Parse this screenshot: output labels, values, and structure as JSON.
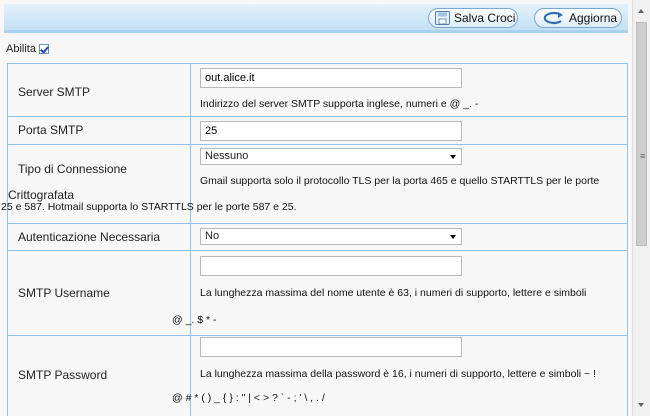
{
  "toolbar": {
    "save_label": "Salva Croci",
    "refresh_label": "Aggiorna"
  },
  "enable": {
    "label": "Abilita",
    "checked": true
  },
  "fields": {
    "server": {
      "label": "Server SMTP",
      "value": "out.alice.it",
      "hint": "Indirizzo del server SMTP supporta inglese, numeri e @ _. -"
    },
    "port": {
      "label": "Porta SMTP",
      "value": "25"
    },
    "encryption": {
      "label_line1": "Tipo di Connessione",
      "label_line2": "Crittografata",
      "selected": "Nessuno",
      "hint_line1": "Gmail supporta solo il protocollo TLS per la porta 465 e quello STARTTLS per le porte",
      "hint_line2": "25 e 587. Hotmail supporta lo STARTTLS per le porte 587 e 25."
    },
    "auth": {
      "label": "Autenticazione Necessaria",
      "selected": "No"
    },
    "username": {
      "label": "SMTP Username",
      "value": "",
      "hint_line1": "La lunghezza massima del nome utente è 63, i numeri di supporto, lettere e simboli",
      "hint_line2": "@ _. $ * -"
    },
    "password": {
      "label": "SMTP Password",
      "value": "",
      "hint_line1": "La lunghezza massima della password è 16, i numeri di supporto, lettere e simboli ~ !",
      "hint_line2": "@ # * ( ) _ { } : \" | < > ? ` - ; ' \\ , . /"
    }
  },
  "colors": {
    "border": "#8fc3ea",
    "toolbar_bottom": "#a8d2ef"
  },
  "icons": [
    "save-icon",
    "refresh-icon",
    "checkbox-checked-icon",
    "dropdown-arrow-icon"
  ]
}
